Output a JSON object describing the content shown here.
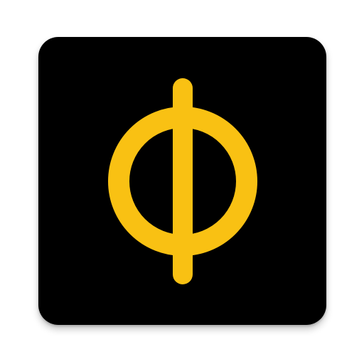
{
  "icon": {
    "name": "phi-symbol-icon",
    "background_color": "#000000",
    "glyph_color": "#F9C113",
    "canvas_color": "#FFFFFF"
  }
}
